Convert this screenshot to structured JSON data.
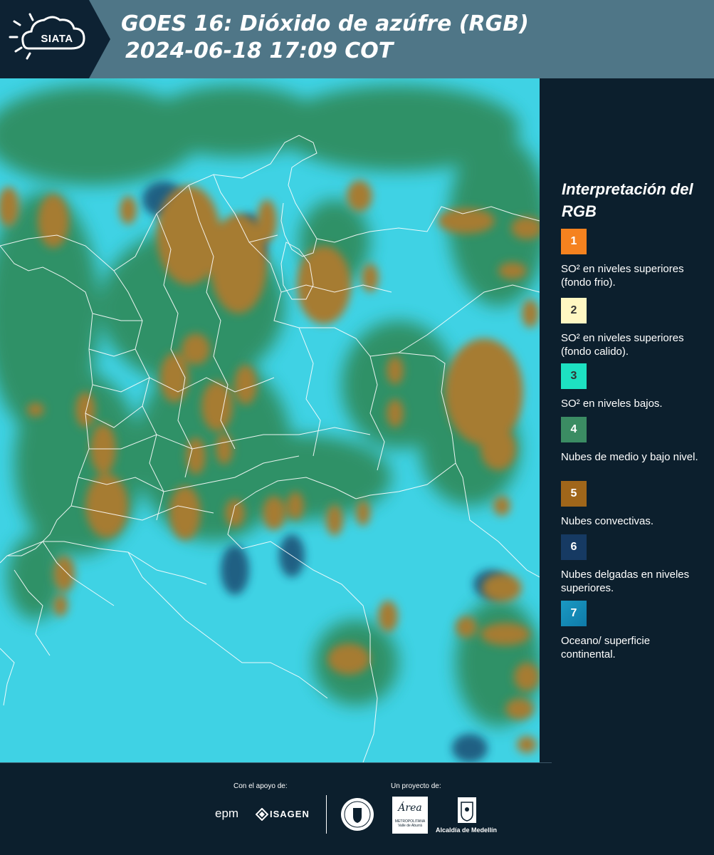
{
  "header": {
    "logo_text": "SIATA",
    "title_line1": "GOES 16: Dióxido de azúfre (RGB)",
    "title_line2": "2024-06-18 17:09 COT"
  },
  "legend": {
    "title": "Interpretación del RGB",
    "items": [
      {
        "number": "1",
        "color": "#f5821f",
        "description": "SO² en niveles superiores (fondo frio)."
      },
      {
        "number": "2",
        "color": "#fff7c2",
        "description": "SO² en niveles superiores (fondo calido)."
      },
      {
        "number": "3",
        "color": "#1de1c2",
        "description": "SO² en niveles bajos."
      },
      {
        "number": "4",
        "color": "#3b8c63",
        "description": "Nubes de medio y bajo nivel."
      },
      {
        "number": "5",
        "color": "#a0661a",
        "description": "Nubes convectivas."
      },
      {
        "number": "6",
        "color": "#163a63",
        "description": "Nubes delgadas en niveles superiores."
      },
      {
        "number": "7",
        "color": "#1a9ac3",
        "description": "Oceano/ superficie continental."
      }
    ]
  },
  "map_colors": {
    "ocean_surface": "#3fd2e4",
    "convective_clouds": "#a67c32",
    "mid_low_clouds": "#2f8a5a",
    "thin_high_clouds": "#163a63",
    "borders": "#ffffff"
  },
  "footer": {
    "support_label": "Con el apoyo de:",
    "project_label": "Un proyecto de:",
    "sponsor_epm": "epm",
    "sponsor_isagen": "ISAGEN",
    "partner_area": "Área",
    "partner_area_caption": "METROPOLITANA Valle de Aburrá",
    "partner_alcaldia": "Alcaldía de Medellín"
  }
}
